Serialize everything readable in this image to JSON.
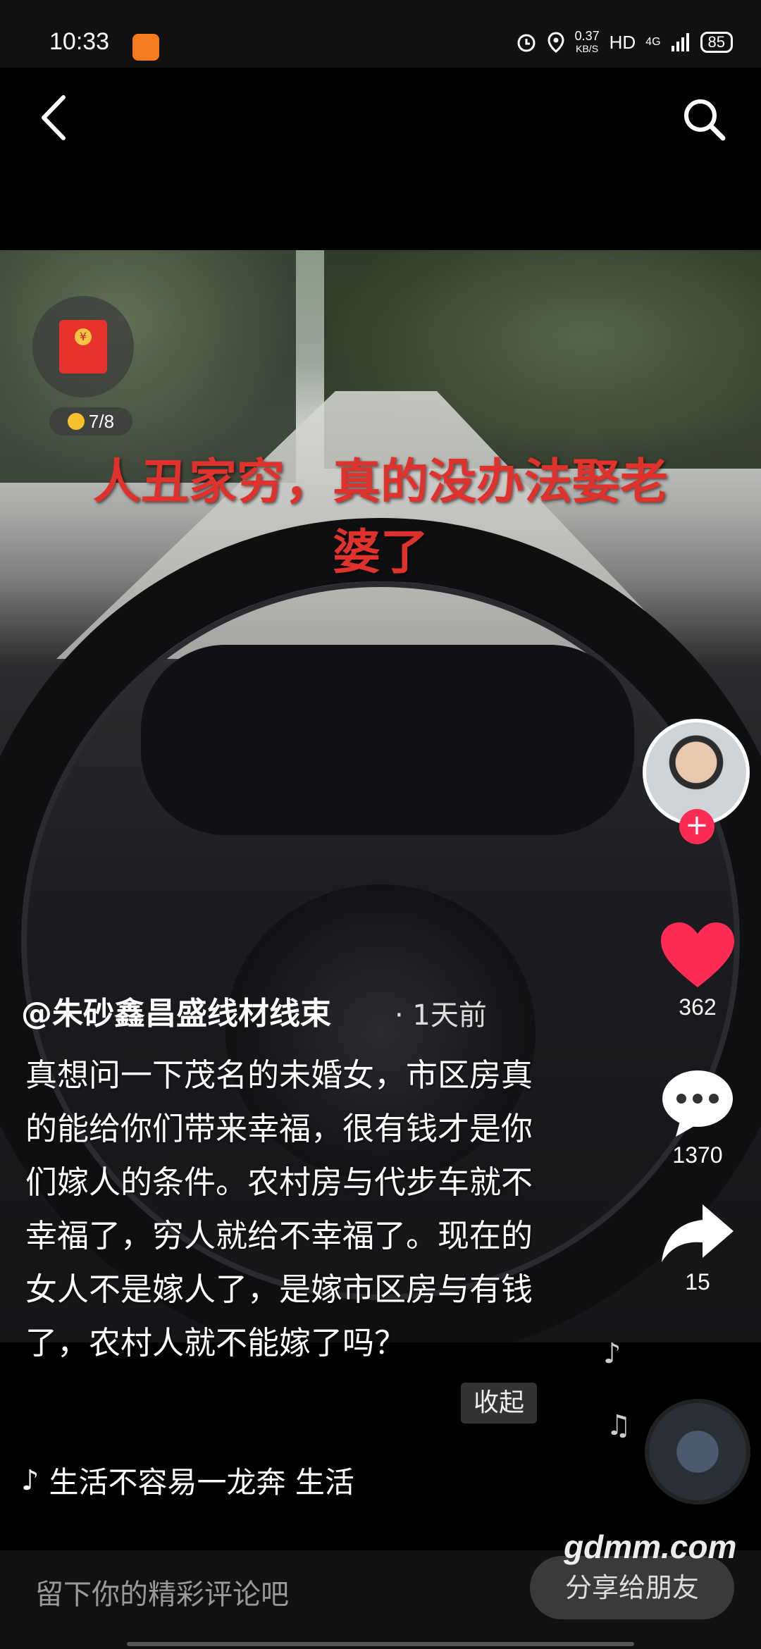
{
  "status_bar": {
    "time": "10:33",
    "net_speed_value": "0.37",
    "net_speed_unit": "KB/S",
    "hd": "HD",
    "network": "4G",
    "battery": "85",
    "icons": [
      "alarm-icon",
      "location-icon",
      "signal-icon",
      "battery-icon"
    ]
  },
  "nav": {
    "back_icon": "chevron-left-icon",
    "search_icon": "search-icon"
  },
  "red_packet": {
    "progress": "7/8"
  },
  "video": {
    "overlay_line1": "人丑家穷，真的没办法娶老",
    "overlay_line2": "婆了"
  },
  "sidebar": {
    "likes": "362",
    "comments": "1370",
    "shares": "15"
  },
  "post": {
    "author": "@朱砂鑫昌盛线材线束",
    "time": "· 1天前",
    "description": "真想问一下茂名的未婚女，市区房真的能给你们带来幸福，很有钱才是你们嫁人的条件。农村房与代步车就不幸福了，穷人就给不幸福了。现在的女人不是嫁人了，是嫁市区房与有钱了，农村人就不能嫁了吗？",
    "collapse": "收起",
    "music": "生活不容易一龙奔    生活"
  },
  "bottom": {
    "comment_placeholder": "留下你的精彩评论吧",
    "share_label": "分享给朋友",
    "watermark": "gdmm.com"
  },
  "colors": {
    "like": "#fe2c55",
    "overlay_text": "#e0322c",
    "background": "#000000"
  }
}
